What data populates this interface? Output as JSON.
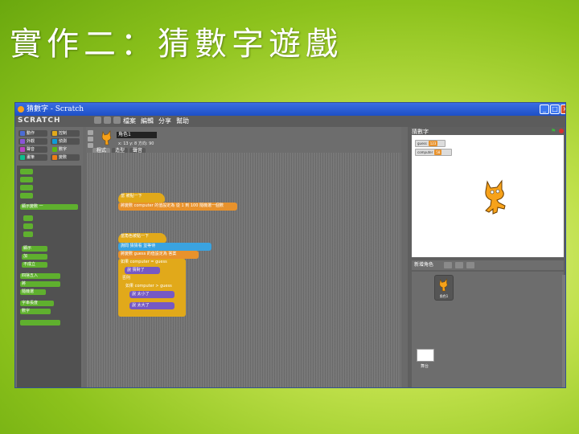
{
  "slide": {
    "title": "實作二：猜數字遊戲"
  },
  "window": {
    "title": "猜數字 - Scratch",
    "minimize": "_",
    "maximize": "□",
    "close": "×"
  },
  "menubar": {
    "logo": "SCRATCH",
    "items": [
      "檔案",
      "編輯",
      "分享",
      "幫助"
    ]
  },
  "categories": [
    {
      "label": "動作",
      "color": "#4a6cd4"
    },
    {
      "label": "控制",
      "color": "#e1a91a"
    },
    {
      "label": "外觀",
      "color": "#8a55d7"
    },
    {
      "label": "偵測",
      "color": "#0e9bd8"
    },
    {
      "label": "聲音",
      "color": "#bb42c3"
    },
    {
      "label": "數字",
      "color": "#5cb712"
    },
    {
      "label": "畫筆",
      "color": "#0fbd8c"
    },
    {
      "label": "變數",
      "color": "#ee7d16"
    }
  ],
  "palette": {
    "b1": "顯示變數 一",
    "b2": "顯示",
    "b3": "加",
    "b4": "不成立",
    "b5": "四捨五入",
    "b6": "將",
    "b7": "隨機選",
    "b8": "字串長度",
    "b9": "數字"
  },
  "sprite": {
    "name": "角色1",
    "coords": "x: 13   y: 8   方向: 90"
  },
  "tabs": [
    "程式",
    "造型",
    "聲音"
  ],
  "scripts": {
    "hat1": "當 被點一下",
    "s1": "將變數 computer 的值設定為 從 1 到 100 隨機選一個數",
    "hat2": "當角色被點一下",
    "s2": "詢問 猜猜看 並等待",
    "s3": "將變數 guess 的值設定為 答案",
    "s4": "如果 computer = guess",
    "s5": "說 猜對了",
    "s6": "否則",
    "s7": "如果 computer > guess",
    "s8": "說 太小了",
    "s9": "說 太大了"
  },
  "stage": {
    "title": "猜數字",
    "var1_label": "guess",
    "var1_value": "123",
    "var2_label": "computer",
    "var2_value": "58"
  },
  "sprites": {
    "bar": "新增角色",
    "sprite1": "角色1",
    "stage": "舞台"
  }
}
